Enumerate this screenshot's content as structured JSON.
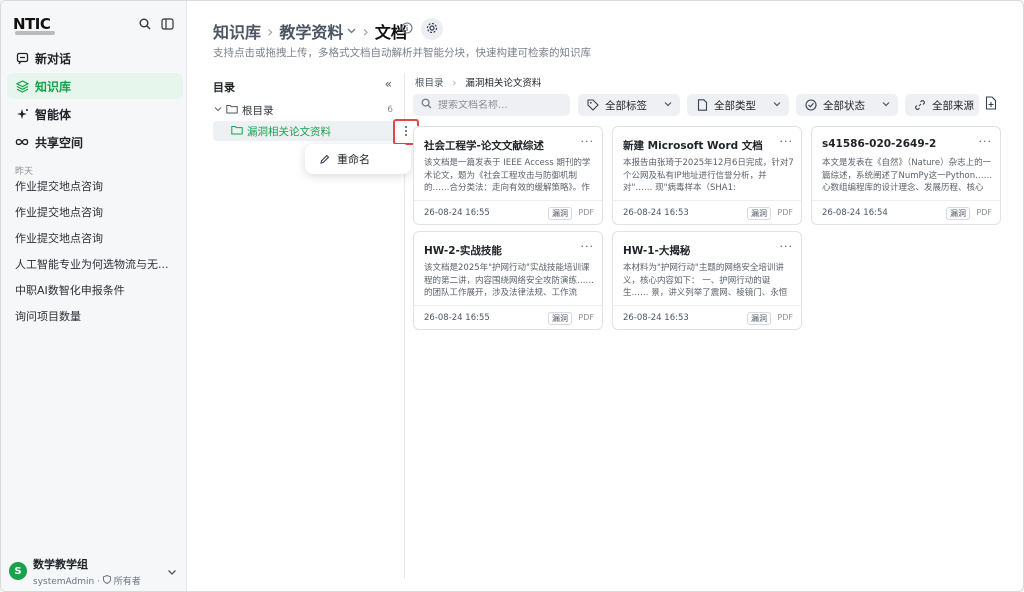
{
  "app": {
    "logo": "NTIC"
  },
  "sidebar": {
    "nav": [
      {
        "label": "新对话",
        "icon": "chat-icon",
        "active": false
      },
      {
        "label": "知识库",
        "icon": "knowledge-base-icon",
        "active": true
      },
      {
        "label": "智能体",
        "icon": "sparkle-icon",
        "active": false
      },
      {
        "label": "共享空间",
        "icon": "infinity-icon",
        "active": false
      }
    ],
    "history_heading": "昨天",
    "history": [
      "作业提交地点咨询",
      "作业提交地点咨询",
      "作业提交地点咨询",
      "人工智能专业为何选物流与无...",
      "中职AI数智化申报条件",
      "询问项目数量"
    ],
    "user": {
      "avatar": "S",
      "name": "数学教学组",
      "account": "systemAdmin",
      "role": "所有者"
    }
  },
  "header": {
    "crumbs": [
      "知识库",
      "教学资料",
      "文档"
    ],
    "subtitle": "支持点击或拖拽上传，多格式文档自动解析并智能分块，快速构建可检索的知识库"
  },
  "tree": {
    "title": "目录",
    "root_label": "根目录",
    "root_count": "6",
    "child_label": "漏洞相关论文资料",
    "menu_item": "重命名"
  },
  "content": {
    "path": [
      "根目录",
      "漏洞相关论文资料"
    ],
    "search_placeholder": "搜索文档名称...",
    "filters": [
      "全部标签",
      "全部类型",
      "全部状态",
      "全部来源"
    ],
    "cards": [
      {
        "title": "社会工程学-论文文献综述",
        "desc": "该文档是一篇发表于 IEEE Access 期刊的学术论文，题为《社会工程攻击与防御机制的……合分类法：走向有效的缓解策略》。作者包……",
        "date": "26-08-24 16:55",
        "tag": "漏洞",
        "type": "PDF"
      },
      {
        "title": "新建 Microsoft Word 文档",
        "desc": "本报告由张琦于2025年12月6日完成，针对7个公网及私有IP地址进行信誉分析，并对\"…… 现\"病毒样本（SHA1:",
        "date": "26-08-24 16:53",
        "tag": "漏洞",
        "type": "PDF"
      },
      {
        "title": "s41586-020-2649-2",
        "desc": "本文是发表在《自然》（Nature）杂志上的一篇综述，系统阐述了NumPy这一Python…… 心数组编程库的设计理念、发展历程、核心",
        "date": "26-08-24 16:54",
        "tag": "漏洞",
        "type": "PDF"
      },
      {
        "title": "HW-2-实战技能",
        "desc": "该文档是2025年\"护网行动\"实战技能培训课程的第二讲，内容围绕网络安全攻防演练…… 的团队工作展开，涉及法律法规、工作流",
        "date": "26-08-24 16:55",
        "tag": "漏洞",
        "type": "PDF"
      },
      {
        "title": "HW-1-大揭秘",
        "desc": "本材料为\"护网行动\"主题的网络安全培训讲义，核心内容如下： 一、护网行动的诞生…… 景，讲义列举了震网、棱镜门、永恒之蓝、",
        "date": "26-08-24 16:53",
        "tag": "漏洞",
        "type": "PDF"
      }
    ]
  },
  "colors": {
    "accent": "#16a34a",
    "active_bg": "#e7f6ec",
    "highlight_border": "#e04848"
  }
}
